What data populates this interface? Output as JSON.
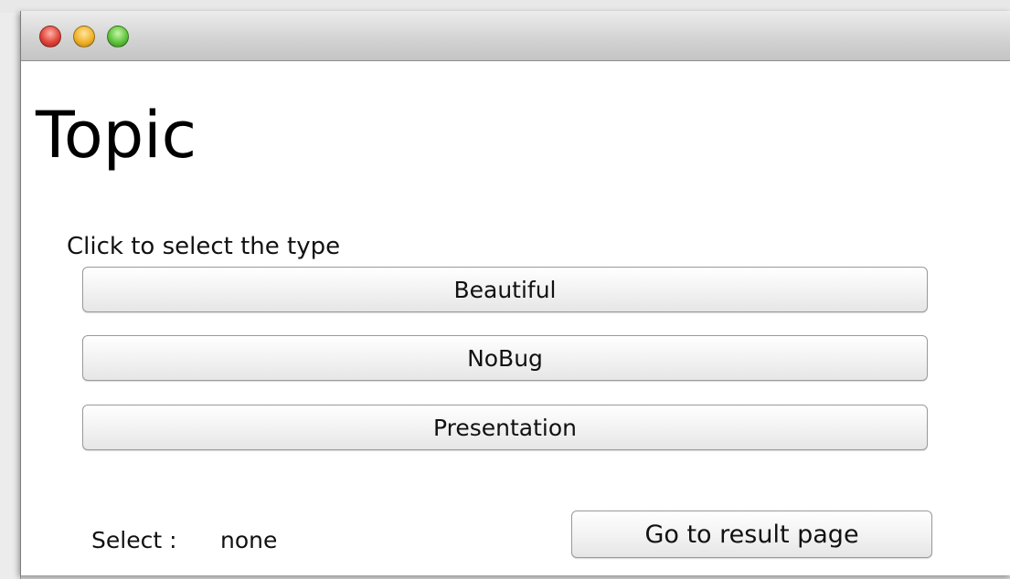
{
  "window": {
    "controls": [
      "close",
      "minimize",
      "zoom"
    ]
  },
  "main": {
    "title": "Topic",
    "prompt": "Click to select the type",
    "options": [
      "Beautiful",
      "NoBug",
      "Presentation"
    ],
    "select_label": "Select :",
    "select_value": "none",
    "go_button": "Go to result page"
  }
}
